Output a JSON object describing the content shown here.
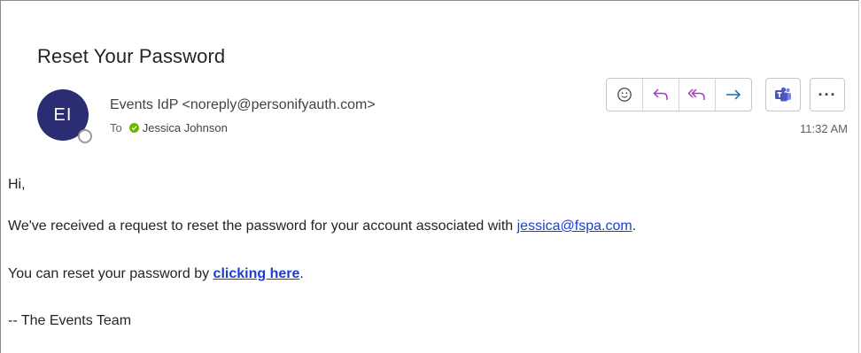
{
  "email": {
    "subject": "Reset Your Password",
    "avatar_initials": "EI",
    "sender": "Events IdP <noreply@personifyauth.com>",
    "to_label": "To",
    "recipient": "Jessica Johnson",
    "time": "11:32 AM"
  },
  "actions": {
    "emoji": "emoji-icon",
    "reply": "reply-icon",
    "reply_all": "reply-all-icon",
    "forward": "forward-icon",
    "teams": "teams-icon",
    "more": "···"
  },
  "body": {
    "greeting": "Hi,",
    "line1_before": "We've received a request to reset the password for your account associated with ",
    "line1_link": "jessica@fspa.com",
    "line1_after": ".",
    "line2_before": "You can reset your password by ",
    "line2_link": "clicking here",
    "line2_after": ".",
    "signature": "-- The Events Team"
  },
  "colors": {
    "avatar_bg": "#2c2c72",
    "link": "#1a3fd8",
    "presence_ok": "#6bb700",
    "action_purple": "#a23bc4",
    "action_blue": "#0f6cbd"
  }
}
